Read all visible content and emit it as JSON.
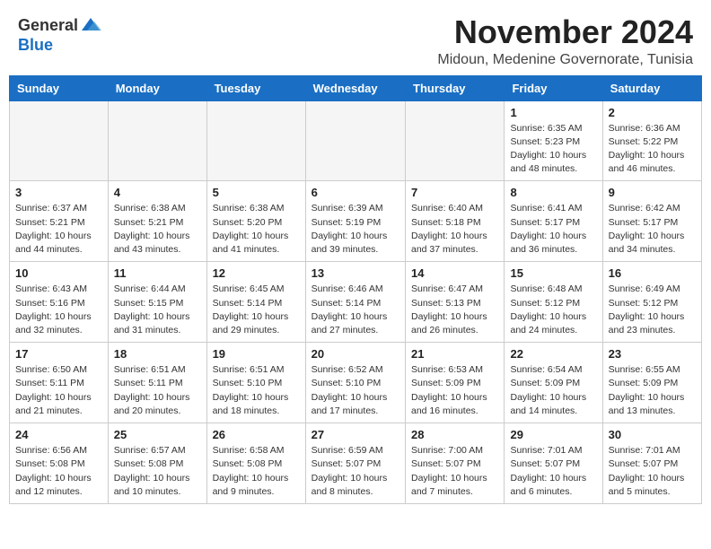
{
  "logo": {
    "general": "General",
    "blue": "Blue"
  },
  "title": "November 2024",
  "location": "Midoun, Medenine Governorate, Tunisia",
  "weekdays": [
    "Sunday",
    "Monday",
    "Tuesday",
    "Wednesday",
    "Thursday",
    "Friday",
    "Saturday"
  ],
  "weeks": [
    [
      {
        "day": "",
        "empty": true
      },
      {
        "day": "",
        "empty": true
      },
      {
        "day": "",
        "empty": true
      },
      {
        "day": "",
        "empty": true
      },
      {
        "day": "",
        "empty": true
      },
      {
        "day": "1",
        "sunrise": "6:35 AM",
        "sunset": "5:23 PM",
        "daylight": "10 hours and 48 minutes."
      },
      {
        "day": "2",
        "sunrise": "6:36 AM",
        "sunset": "5:22 PM",
        "daylight": "10 hours and 46 minutes."
      }
    ],
    [
      {
        "day": "3",
        "sunrise": "6:37 AM",
        "sunset": "5:21 PM",
        "daylight": "10 hours and 44 minutes."
      },
      {
        "day": "4",
        "sunrise": "6:38 AM",
        "sunset": "5:21 PM",
        "daylight": "10 hours and 43 minutes."
      },
      {
        "day": "5",
        "sunrise": "6:38 AM",
        "sunset": "5:20 PM",
        "daylight": "10 hours and 41 minutes."
      },
      {
        "day": "6",
        "sunrise": "6:39 AM",
        "sunset": "5:19 PM",
        "daylight": "10 hours and 39 minutes."
      },
      {
        "day": "7",
        "sunrise": "6:40 AM",
        "sunset": "5:18 PM",
        "daylight": "10 hours and 37 minutes."
      },
      {
        "day": "8",
        "sunrise": "6:41 AM",
        "sunset": "5:17 PM",
        "daylight": "10 hours and 36 minutes."
      },
      {
        "day": "9",
        "sunrise": "6:42 AM",
        "sunset": "5:17 PM",
        "daylight": "10 hours and 34 minutes."
      }
    ],
    [
      {
        "day": "10",
        "sunrise": "6:43 AM",
        "sunset": "5:16 PM",
        "daylight": "10 hours and 32 minutes."
      },
      {
        "day": "11",
        "sunrise": "6:44 AM",
        "sunset": "5:15 PM",
        "daylight": "10 hours and 31 minutes."
      },
      {
        "day": "12",
        "sunrise": "6:45 AM",
        "sunset": "5:14 PM",
        "daylight": "10 hours and 29 minutes."
      },
      {
        "day": "13",
        "sunrise": "6:46 AM",
        "sunset": "5:14 PM",
        "daylight": "10 hours and 27 minutes."
      },
      {
        "day": "14",
        "sunrise": "6:47 AM",
        "sunset": "5:13 PM",
        "daylight": "10 hours and 26 minutes."
      },
      {
        "day": "15",
        "sunrise": "6:48 AM",
        "sunset": "5:12 PM",
        "daylight": "10 hours and 24 minutes."
      },
      {
        "day": "16",
        "sunrise": "6:49 AM",
        "sunset": "5:12 PM",
        "daylight": "10 hours and 23 minutes."
      }
    ],
    [
      {
        "day": "17",
        "sunrise": "6:50 AM",
        "sunset": "5:11 PM",
        "daylight": "10 hours and 21 minutes."
      },
      {
        "day": "18",
        "sunrise": "6:51 AM",
        "sunset": "5:11 PM",
        "daylight": "10 hours and 20 minutes."
      },
      {
        "day": "19",
        "sunrise": "6:51 AM",
        "sunset": "5:10 PM",
        "daylight": "10 hours and 18 minutes."
      },
      {
        "day": "20",
        "sunrise": "6:52 AM",
        "sunset": "5:10 PM",
        "daylight": "10 hours and 17 minutes."
      },
      {
        "day": "21",
        "sunrise": "6:53 AM",
        "sunset": "5:09 PM",
        "daylight": "10 hours and 16 minutes."
      },
      {
        "day": "22",
        "sunrise": "6:54 AM",
        "sunset": "5:09 PM",
        "daylight": "10 hours and 14 minutes."
      },
      {
        "day": "23",
        "sunrise": "6:55 AM",
        "sunset": "5:09 PM",
        "daylight": "10 hours and 13 minutes."
      }
    ],
    [
      {
        "day": "24",
        "sunrise": "6:56 AM",
        "sunset": "5:08 PM",
        "daylight": "10 hours and 12 minutes."
      },
      {
        "day": "25",
        "sunrise": "6:57 AM",
        "sunset": "5:08 PM",
        "daylight": "10 hours and 10 minutes."
      },
      {
        "day": "26",
        "sunrise": "6:58 AM",
        "sunset": "5:08 PM",
        "daylight": "10 hours and 9 minutes."
      },
      {
        "day": "27",
        "sunrise": "6:59 AM",
        "sunset": "5:07 PM",
        "daylight": "10 hours and 8 minutes."
      },
      {
        "day": "28",
        "sunrise": "7:00 AM",
        "sunset": "5:07 PM",
        "daylight": "10 hours and 7 minutes."
      },
      {
        "day": "29",
        "sunrise": "7:01 AM",
        "sunset": "5:07 PM",
        "daylight": "10 hours and 6 minutes."
      },
      {
        "day": "30",
        "sunrise": "7:01 AM",
        "sunset": "5:07 PM",
        "daylight": "10 hours and 5 minutes."
      }
    ]
  ]
}
